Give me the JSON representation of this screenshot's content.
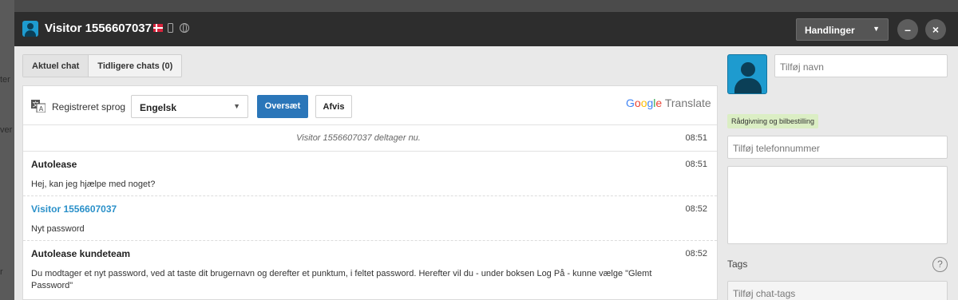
{
  "background": {
    "left_texts": [
      "ter",
      "ver",
      "r"
    ]
  },
  "titlebar": {
    "title": "Visitor 1556607037",
    "actions_label": "Handlinger",
    "minimize_label": "–",
    "close_label": "×"
  },
  "tabs": [
    {
      "label": "Aktuel chat",
      "active": true
    },
    {
      "label": "Tidligere chats (0)",
      "active": false
    }
  ],
  "translate": {
    "label": "Registreret sprog",
    "selected_language": "Engelsk",
    "translate_button": "Oversæt",
    "dismiss_button": "Afvis",
    "brand_google": [
      "G",
      "o",
      "o",
      "g",
      "l",
      "e"
    ],
    "brand_translate": "Translate"
  },
  "messages": [
    {
      "type": "system",
      "text": "Visitor 1556607037 deltager nu.",
      "time": "08:51"
    },
    {
      "type": "agent",
      "sender": "Autolease",
      "text": "Hej, kan jeg hjælpe med noget?",
      "time": "08:51"
    },
    {
      "type": "visitor",
      "sender": "Visitor 1556607037",
      "text": "Nyt password",
      "time": "08:52"
    },
    {
      "type": "agent",
      "sender": "Autolease kundeteam",
      "text": "Du modtager et nyt password, ved at taste dit brugernavn og derefter et punktum, i feltet password. Herefter vil du - under boksen Log På - kunne vælge \"Glemt Password\"",
      "time": "08:52"
    }
  ],
  "sidebar": {
    "name_placeholder": "Tilføj navn",
    "tag_badge": "Rådgivning og bilbestilling",
    "phone_placeholder": "Tilføj telefonnummer",
    "tags_label": "Tags",
    "help_label": "?",
    "chat_tags_placeholder": "Tilføj chat-tags"
  },
  "colors": {
    "accent_blue": "#2b76b9",
    "visitor_name": "#2a90c9",
    "avatar": "#1e9bcf",
    "titlebar": "#2d2d2d",
    "tag_badge_bg": "#dbeec4"
  }
}
